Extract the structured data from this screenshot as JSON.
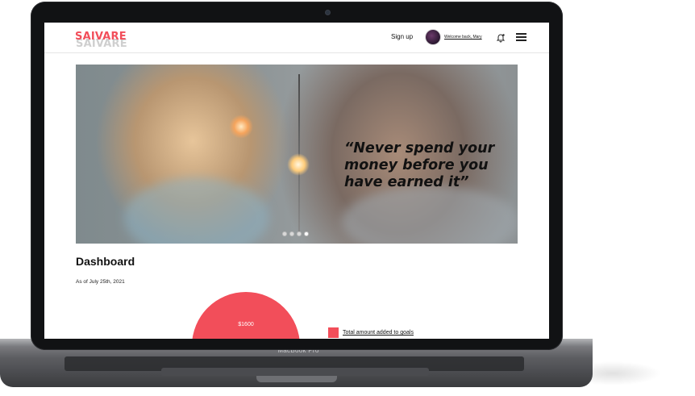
{
  "device": {
    "label": "MacBook Pro"
  },
  "header": {
    "logo": "SAIVARE",
    "logo_shadow": "SAIVARE",
    "signup_label": "Sign up",
    "welcome_text": "Welcome back, Mary",
    "icons": [
      "bell-icon",
      "hamburger-menu-icon"
    ]
  },
  "hero": {
    "quote": "“Never spend your money before you have earned it”",
    "carousel_dots": 4,
    "active_dot": 4
  },
  "dashboard": {
    "title": "Dashboard",
    "as_of": "As of July 25th, 2021",
    "amount": "$1600",
    "legend_label": "Total amount added to goals"
  },
  "colors": {
    "accent": "#f24e5a",
    "text": "#111111"
  }
}
